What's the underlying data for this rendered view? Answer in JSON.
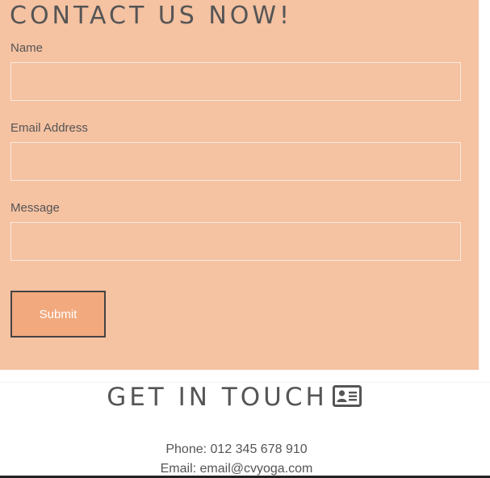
{
  "contact_form": {
    "title": "CONTACT US NOW!",
    "fields": [
      {
        "label": "Name",
        "value": ""
      },
      {
        "label": "Email Address",
        "value": ""
      },
      {
        "label": "Message",
        "value": ""
      }
    ],
    "submit_label": "Submit"
  },
  "get_in_touch": {
    "heading": "GET IN TOUCH",
    "icon": "contact-card-icon",
    "phone": "Phone: 012 345 678 910",
    "email": "Email: email@cvyoga.com"
  },
  "colors": {
    "panel_background": "#f5c2a2",
    "button_background": "#f2a97e",
    "text": "#555555"
  }
}
